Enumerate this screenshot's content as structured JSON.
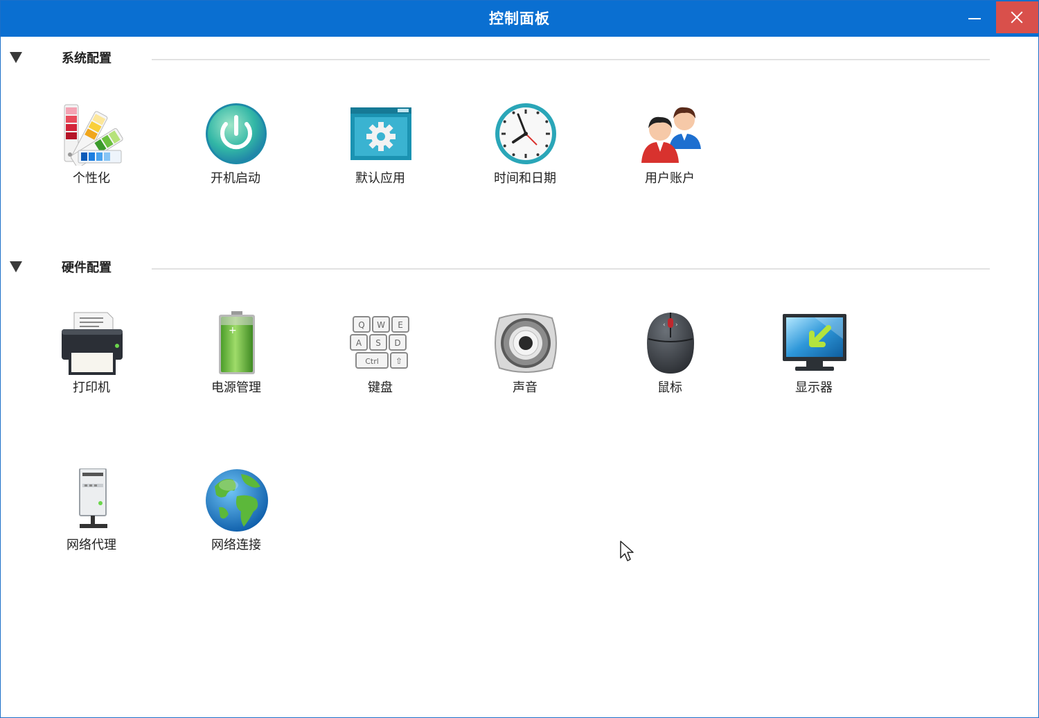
{
  "window": {
    "title": "控制面板"
  },
  "sections": [
    {
      "label": "系统配置",
      "items": [
        {
          "label": "个性化",
          "icon": "color-palette-icon"
        },
        {
          "label": "开机启动",
          "icon": "power-icon"
        },
        {
          "label": "默认应用",
          "icon": "gear-window-icon"
        },
        {
          "label": "时间和日期",
          "icon": "clock-icon"
        },
        {
          "label": "用户账户",
          "icon": "users-icon"
        }
      ]
    },
    {
      "label": "硬件配置",
      "items": [
        {
          "label": "打印机",
          "icon": "printer-icon"
        },
        {
          "label": "电源管理",
          "icon": "battery-icon"
        },
        {
          "label": "键盘",
          "icon": "keyboard-icon"
        },
        {
          "label": "声音",
          "icon": "speaker-icon"
        },
        {
          "label": "鼠标",
          "icon": "mouse-icon"
        },
        {
          "label": "显示器",
          "icon": "monitor-icon"
        },
        {
          "label": "网络代理",
          "icon": "network-server-icon"
        },
        {
          "label": "网络连接",
          "icon": "globe-icon"
        }
      ]
    }
  ]
}
